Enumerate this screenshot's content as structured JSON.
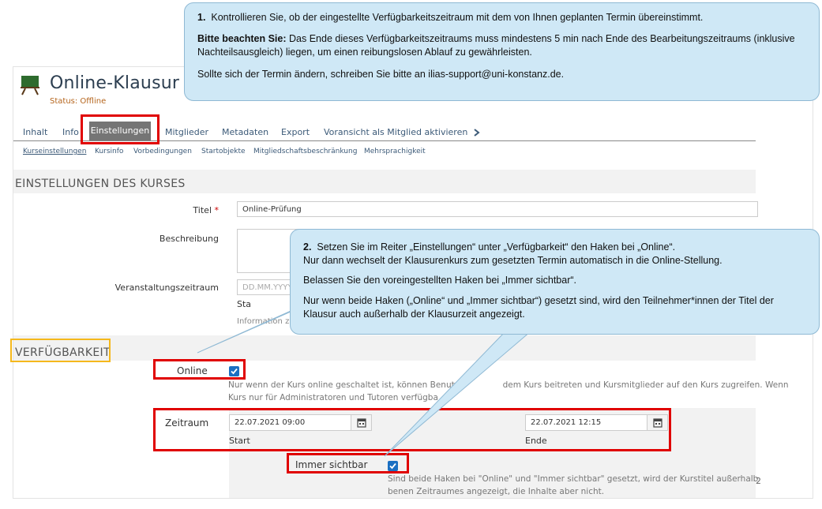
{
  "course": {
    "title": "Online-Klausur",
    "status": "Status: Offline"
  },
  "tabs": [
    "Inhalt",
    "Info",
    "Einstellungen",
    "Mitglieder",
    "Metadaten",
    "Export",
    "Voransicht als Mitglied aktivieren"
  ],
  "subtabs": [
    "Kurseinstellungen",
    "Kursinfo",
    "Vorbedingungen",
    "Startobjekte",
    "Mitgliedschaftsbeschränkung",
    "Mehrsprachigkeit"
  ],
  "settings": {
    "heading": "EINSTELLUNGEN DES KURSES",
    "title_label": "Titel",
    "required_mark": "*",
    "title_value": "Online-Prüfung",
    "description_label": "Beschreibung",
    "event_period_label": "Veranstaltungszeitraum",
    "event_period_placeholder": "DD.MM.YYYY",
    "event_start_partial": "Sta",
    "event_info_partial": "Information z"
  },
  "availability": {
    "heading": "VERFÜGBARKEIT",
    "online_label": "Online",
    "online_info_line1": "Nur wenn der Kurs online geschaltet ist, können Benutz",
    "online_info_line1b": "dem Kurs beitreten und Kursmitglieder auf den Kurs zugreifen. Wenn",
    "online_info_line2": "Kurs nur für Administratoren und Tutoren verfügba",
    "period_label": "Zeitraum",
    "start_value": "22.07.2021 09:00",
    "start_label": "Start",
    "end_value": "22.07.2021 12:15",
    "end_label": "Ende",
    "always_visible_label": "Immer sichtbar",
    "visible_info_line1": "Sind beide Haken bei \"Online\" und \"Immer sichtbar\" gesetzt, wird der Kurstitel außerhalb",
    "visible_info_line2": "benen Zeitraumes angezeigt, die Inhalte aber nicht.",
    "cut_char": "2"
  },
  "callout1": {
    "num": "1.",
    "line1": "Kontrollieren Sie, ob der eingestellte Verfügbarkeitszeitraum mit dem von Ihnen geplanten Termin übereinstimmt.",
    "bold": "Bitte beachten Sie:",
    "line2": "Das Ende dieses Verfügbarkeitszeitraums muss mindestens 5 min nach Ende des Bearbeitungszeitraums (inklusive Nachteilsausgleich) liegen, um einen reibungslosen Ablauf zu gewährleisten.",
    "line3": "Sollte sich der Termin ändern, schreiben Sie bitte an ilias-support@uni-konstanz.de."
  },
  "callout2": {
    "num": "2.",
    "line1": "Setzen Sie im Reiter „Einstellungen“ unter „Verfügbarkeit“ den Haken bei „Online“.",
    "line1b": "Nur dann wechselt der Klausurenkurs zum gesetzten Termin automatisch in die Online-Stellung.",
    "line2": "Belassen Sie den voreingestellten Haken bei „Immer sichtbar“.",
    "line3": "Nur wenn beide Haken („Online“ und „Immer sichtbar“) gesetzt sind, wird den Teilnehmer*innen der Titel der Klausur auch außerhalb der Klausurzeit angezeigt."
  },
  "colors": {
    "highlight_red": "#e00000",
    "highlight_orange": "#f5b81c",
    "callout_bg": "#cfe8f6",
    "checkbox_blue": "#1a6fc2",
    "active_tab": "#757575"
  }
}
